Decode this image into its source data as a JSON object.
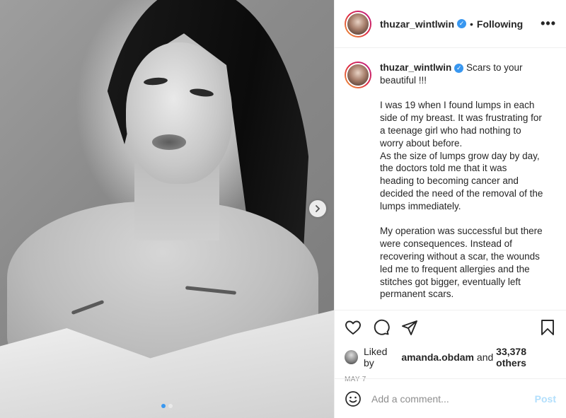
{
  "post": {
    "author": "thuzar_wintlwin",
    "follow_separator": "•",
    "follow_status": "Following",
    "more_label": "•••"
  },
  "caption": {
    "username": "thuzar_wintlwin",
    "first_line": "Scars to your beautiful !!!",
    "paragraph1": [
      "I was 19 when I found lumps in each",
      "side of my breast. It was frustrating for",
      "a teenage girl who had nothing to",
      "worry about before.",
      "As the size of lumps grow day by day,",
      "the doctors told me that it was",
      "heading to becoming cancer and",
      "decided the need of the removal of the",
      "lumps immediately."
    ],
    "paragraph2": [
      "My operation was successful but there",
      "were consequences. Instead of",
      "recovering without a scar, the wounds",
      "led me to frequent allergies and the",
      "stitches got bigger, eventually left",
      "permanent scars."
    ]
  },
  "likes": {
    "prefix": "Liked by",
    "user": "amanda.obdam",
    "conjunction": "and",
    "others": "33,378 others"
  },
  "date": "MAY 7",
  "comment": {
    "placeholder": "Add a comment...",
    "post_label": "Post"
  },
  "carousel": {
    "current_slide": 1,
    "total_slides": 2
  },
  "colors": {
    "accent": "#3897f0",
    "post_disabled": "#b2dffc",
    "muted": "#8e8e8e"
  },
  "icons": [
    "verified-badge-icon",
    "more-options-icon",
    "chevron-right-icon",
    "heart-icon",
    "comment-icon",
    "share-icon",
    "bookmark-icon",
    "emoji-icon"
  ]
}
